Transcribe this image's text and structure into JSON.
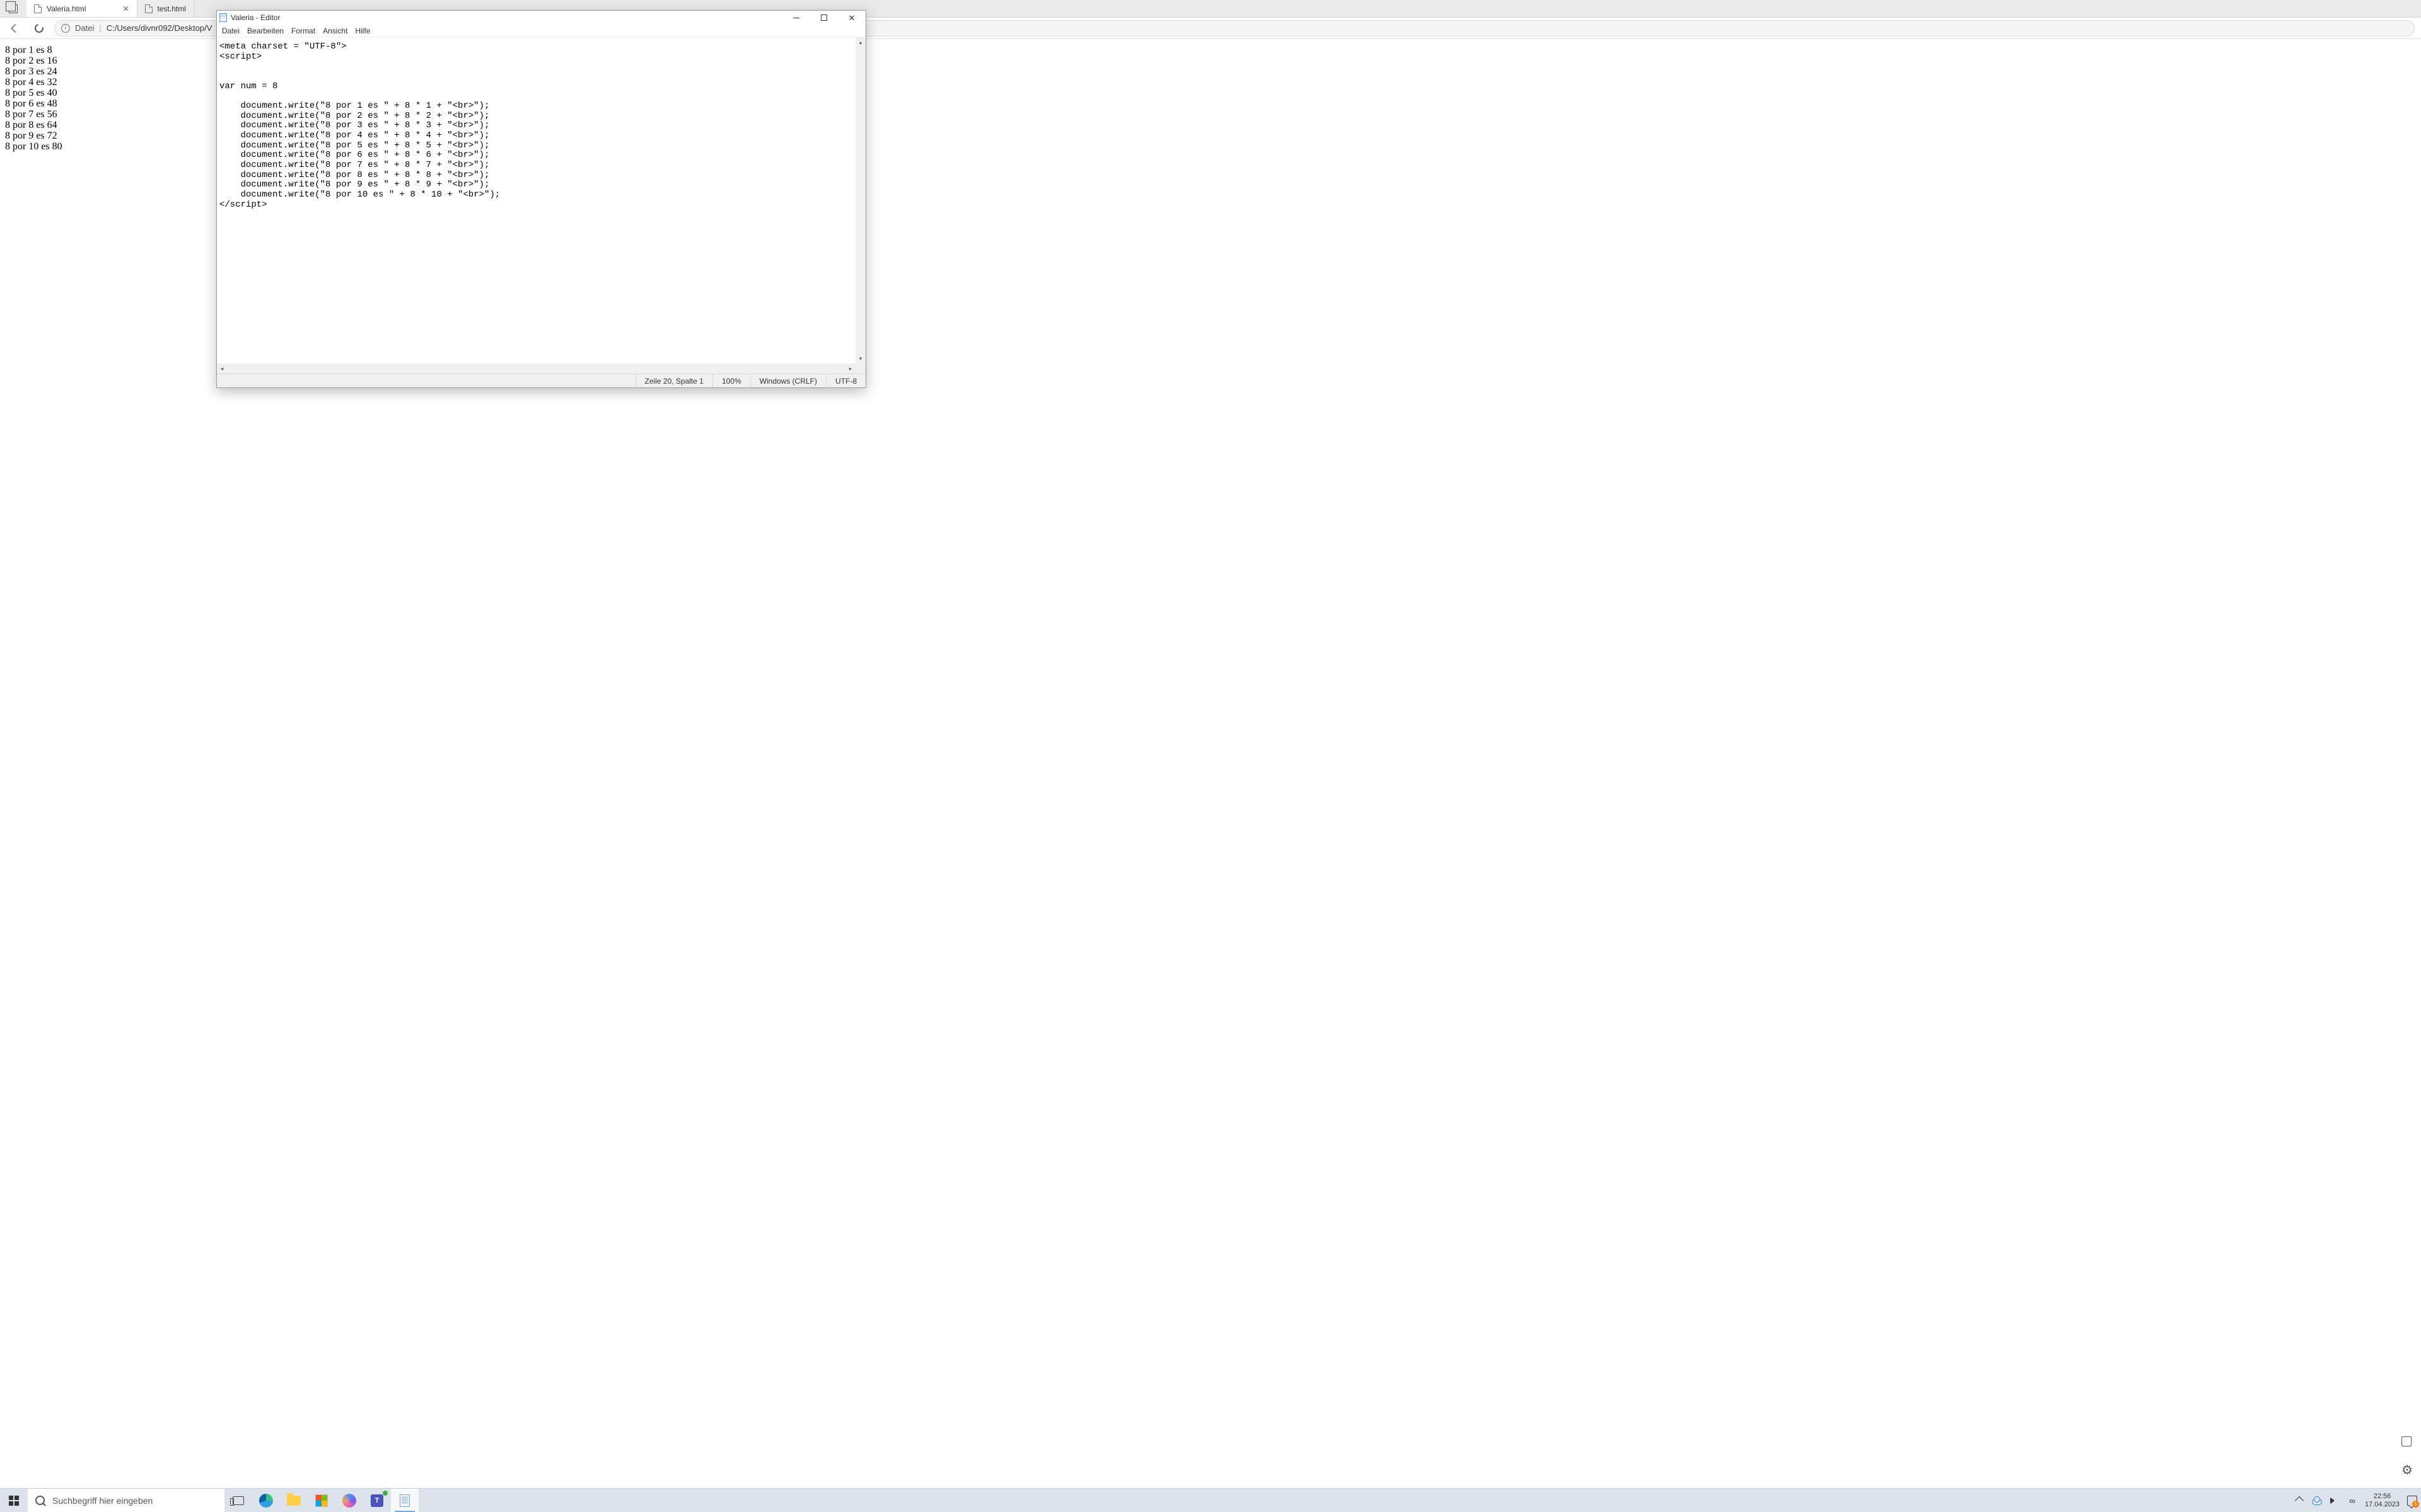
{
  "browser": {
    "tabs": [
      {
        "title": "Valeria.html",
        "active": true
      },
      {
        "title": "test.html",
        "active": false
      }
    ],
    "url_scheme": "Datei",
    "url_path": "C:/Users/divnr092/Desktop/V",
    "page_lines": [
      "8 por 1 es 8",
      "8 por 2 es 16",
      "8 por 3 es 24",
      "8 por 4 es 32",
      "8 por 5 es 40",
      "8 por 6 es 48",
      "8 por 7 es 56",
      "8 por 8 es 64",
      "8 por 9 es 72",
      "8 por 10 es 80"
    ]
  },
  "notepad": {
    "title": "Valeria - Editor",
    "menu": [
      "Datei",
      "Bearbeiten",
      "Format",
      "Ansicht",
      "Hilfe"
    ],
    "content": "<meta charset = \"UTF-8\">\n<script>\n\n\nvar num = 8\n\n    document.write(\"8 por 1 es \" + 8 * 1 + \"<br>\");\n    document.write(\"8 por 2 es \" + 8 * 2 + \"<br>\");\n    document.write(\"8 por 3 es \" + 8 * 3 + \"<br>\");\n    document.write(\"8 por 4 es \" + 8 * 4 + \"<br>\");\n    document.write(\"8 por 5 es \" + 8 * 5 + \"<br>\");\n    document.write(\"8 por 6 es \" + 8 * 6 + \"<br>\");\n    document.write(\"8 por 7 es \" + 8 * 7 + \"<br>\");\n    document.write(\"8 por 8 es \" + 8 * 8 + \"<br>\");\n    document.write(\"8 por 9 es \" + 8 * 9 + \"<br>\");\n    document.write(\"8 por 10 es \" + 8 * 10 + \"<br>\");\n</script>",
    "status": {
      "cursor": "Zeile 20, Spalte 1",
      "zoom": "100%",
      "eol": "Windows (CRLF)",
      "encoding": "UTF-8"
    }
  },
  "taskbar": {
    "search_placeholder": "Suchbegriff hier eingeben",
    "time": "22:56",
    "date": "17.04.2023",
    "notif_count": "5"
  }
}
